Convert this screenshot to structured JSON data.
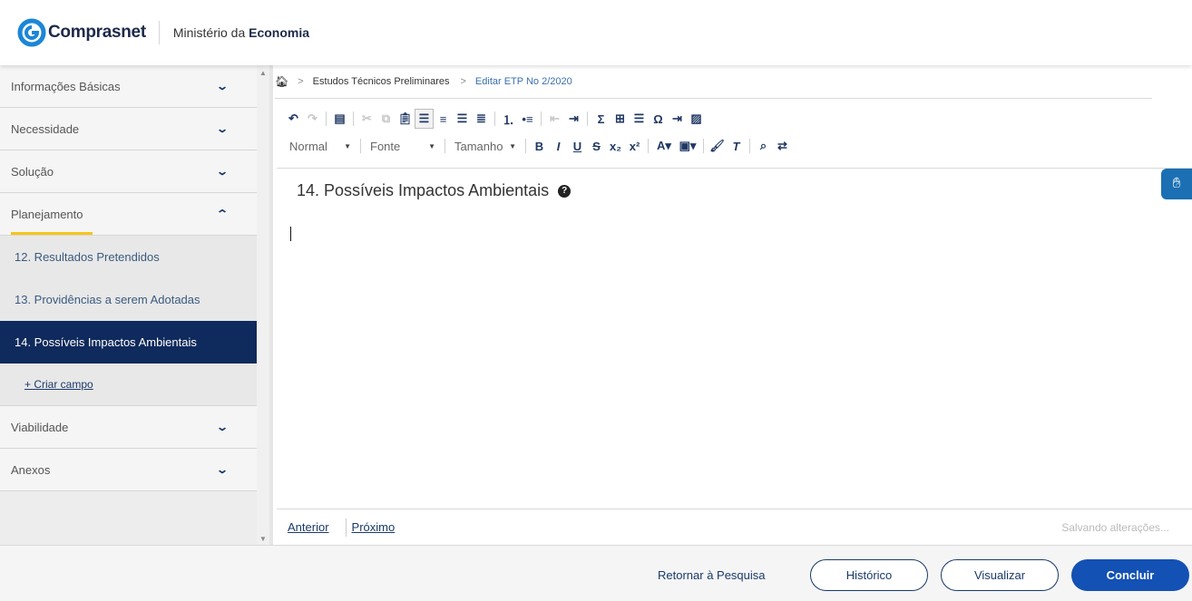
{
  "header": {
    "logo_text": "Comprasnet",
    "ministry_prefix": "Ministério da",
    "ministry_bold": "Economia"
  },
  "sidebar": {
    "items": [
      {
        "label": "Informações Básicas"
      },
      {
        "label": "Necessidade"
      },
      {
        "label": "Solução"
      },
      {
        "label": "Planejamento"
      },
      {
        "label": "Viabilidade"
      },
      {
        "label": "Anexos"
      }
    ],
    "planejamento_sub": [
      {
        "label": "12. Resultados Pretendidos"
      },
      {
        "label": "13. Providências a serem Adotadas"
      },
      {
        "label": "14. Possíveis Impactos Ambientais"
      }
    ],
    "create_field": "+ Criar campo"
  },
  "breadcrumb": {
    "items": [
      "Estudos Técnicos Preliminares",
      "Editar ETP No 2/2020"
    ]
  },
  "toolbar": {
    "format": "Normal",
    "font": "Fonte",
    "size": "Tamanho"
  },
  "editor": {
    "field_title": "14. Possíveis Impactos Ambientais"
  },
  "nav": {
    "prev": "Anterior",
    "next": "Próximo",
    "status": "Salvando alterações..."
  },
  "footer": {
    "return": "Retornar à Pesquisa",
    "history": "Histórico",
    "preview": "Visualizar",
    "finish": "Concluir"
  },
  "colors": {
    "primary": "#1351b4",
    "active_nav": "#0f2a5c",
    "accent_underline": "#f5c518"
  }
}
